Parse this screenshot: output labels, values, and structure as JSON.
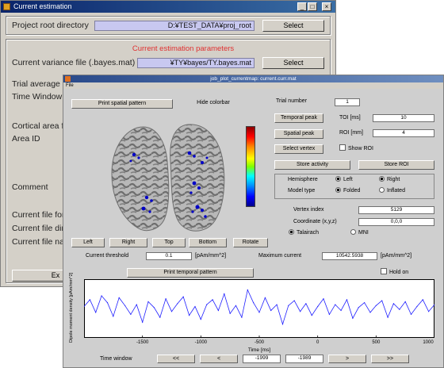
{
  "back_window": {
    "title": "Current estimation",
    "controls": {
      "minimize": "_",
      "maximize": "□",
      "close": "×"
    },
    "project_root_label": "Project root directory",
    "project_root_value": "D:¥TEST_DATA¥proj_root",
    "select_label": "Select",
    "params_header": "Current estimation parameters",
    "variance_label": "Current variance file (.bayes.mat)",
    "variance_value": "¥TY¥bayes/TY.bayes.mat",
    "trial_average_label": "Trial average",
    "time_window_label": "Time Window [",
    "cortical_area_label": "Cortical area f",
    "area_id_label": "Area ID",
    "comment_label": "Comment",
    "current_file_for_label": "Current file for",
    "current_file_dir_label": "Current file dir",
    "current_file_name_label": "Current file na",
    "exec_label": "Ex"
  },
  "front_window": {
    "title": "job_plot_currentmap: current.curr.mat",
    "menu": "File",
    "print_spatial_label": "Print spatial pattern",
    "hide_colorbar_label": "Hide colorbar",
    "trial_number_label": "Trial number",
    "trial_number_value": "1",
    "temporal_peak_label": "Temporal peak",
    "toi_label": "TOI [ms]",
    "toi_value": "10",
    "spatial_peak_label": "Spatial peak",
    "roi_label": "ROI [mm]",
    "roi_value": "4",
    "select_vertex_label": "Select vertex",
    "show_roi_label": "Show ROI",
    "store_activity_label": "Store activity",
    "store_roi_label": "Store ROI",
    "hemisphere_label": "Hemisphere",
    "left_radio_label": "Left",
    "right_radio_label": "Right",
    "model_type_label": "Model type",
    "folded_label": "Folded",
    "inflated_label": "Inflated",
    "vertex_index_label": "Vertex index",
    "vertex_index_value": "5129",
    "coordinate_label": "Coordinate (x,y,z)",
    "coordinate_value": "0,0,0",
    "talairach_label": "Talairach",
    "mni_label": "MNI",
    "view_left_label": "Left",
    "view_right_label": "Right",
    "view_top_label": "Top",
    "view_bottom_label": "Bottom",
    "view_rotate_label": "Rotate",
    "current_threshold_label": "Current threshold",
    "current_threshold_value": "0.1",
    "threshold_unit": "[pAm/mm^2]",
    "max_current_label": "Maximum current",
    "max_current_value": "10542.5938",
    "max_current_unit": "[pAm/mm^2]",
    "print_temporal_label": "Print temporal pattern",
    "hold_on_label": "Hold on",
    "time_window_label": "Time window",
    "time_window_start": "-1999",
    "time_window_end": "-1989",
    "nav_first": "<<",
    "nav_prev": "<",
    "nav_next": ">",
    "nav_last": ">>",
    "colors": {
      "brain": "#9a9a9a",
      "trace": "#1f1fff",
      "activation": "#0000c8"
    }
  },
  "chart_data": {
    "type": "line",
    "xlabel": "Time [ms]",
    "ylabel": "Dipole moment density [pAm/mm^2]",
    "xlim": [
      -2000,
      1000
    ],
    "xticks": [
      -1500,
      -1000,
      -500,
      0,
      500,
      1000
    ],
    "x_tick_labels": [
      "-1500",
      "-1000",
      "-500",
      "0",
      "500",
      "1000"
    ],
    "ylim": [
      -3,
      3
    ],
    "series": [
      {
        "x": [
          -2000,
          -1950,
          -1900,
          -1850,
          -1800,
          -1750,
          -1700,
          -1650,
          -1600,
          -1550,
          -1500,
          -1450,
          -1400,
          -1350,
          -1300,
          -1250,
          -1200,
          -1150,
          -1100,
          -1050,
          -1000,
          -950,
          -900,
          -850,
          -800,
          -750,
          -700,
          -650,
          -600,
          -550,
          -500,
          -450,
          -400,
          -350,
          -300,
          -250,
          -200,
          -150,
          -100,
          -50,
          0,
          50,
          100,
          150,
          200,
          250,
          300,
          350,
          400,
          450,
          500,
          550,
          600,
          650,
          700,
          750,
          800,
          850,
          900,
          950,
          1000
        ],
        "y": [
          0.2,
          0.9,
          -0.4,
          1.3,
          0.6,
          -0.8,
          1.1,
          0.3,
          -0.6,
          0.4,
          -1.4,
          0.7,
          0.1,
          -0.9,
          1.0,
          -0.3,
          0.5,
          1.2,
          -0.7,
          0.2,
          -1.1,
          0.4,
          0.9,
          -0.2,
          1.5,
          -0.5,
          0.3,
          -0.9,
          1.9,
          0.6,
          -0.4,
          1.1,
          -0.2,
          0.4,
          -1.6,
          0.3,
          0.8,
          -0.3,
          0.5,
          -0.7,
          0.2,
          1.0,
          -0.6,
          0.4,
          -0.2,
          0.9,
          -1.0,
          0.1,
          0.6,
          -0.4,
          0.3,
          0.8,
          -0.9,
          0.5,
          -0.1,
          0.7,
          -0.6,
          0.2,
          0.9,
          -0.3,
          0.4
        ]
      }
    ]
  }
}
